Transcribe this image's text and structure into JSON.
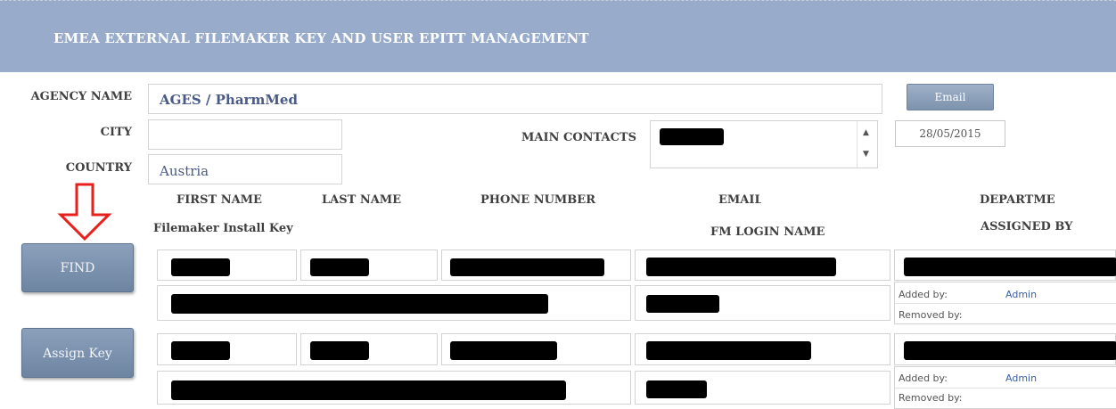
{
  "header": {
    "title": "EMEA EXTERNAL FILEMAKER KEY AND USER EPITT MANAGEMENT"
  },
  "form": {
    "agency_label": "AGENCY NAME",
    "agency_value": "AGES / PharmMed",
    "city_label": "CITY",
    "city_value": "",
    "country_label": "COUNTRY",
    "country_value": "Austria",
    "main_contacts_label": "MAIN CONTACTS",
    "email_button": "Email",
    "date": "28/05/2015"
  },
  "columns": {
    "first_name": "FIRST NAME",
    "last_name": "LAST NAME",
    "phone": "PHONE NUMBER",
    "email": "EMAIL ADDRESS",
    "department": "DEPARTMENT",
    "install_key": "Filemaker Install Key",
    "fm_login": "FM LOGIN NAME",
    "assigned_by": "ASSIGNED BY"
  },
  "buttons": {
    "find": "FIND",
    "assign_key": "Assign Key"
  },
  "records": [
    {
      "added_by_label": "Added by:",
      "added_by_value": "Admin",
      "removed_by_label": "Removed by:"
    },
    {
      "added_by_label": "Added by:",
      "added_by_value": "Admin",
      "removed_by_label": "Removed by:"
    }
  ],
  "annotation": {
    "arrow_color": "#e8201c"
  },
  "colors": {
    "header": "#98abcb",
    "button": "#7d92ad",
    "value_text": "#4a5a88"
  }
}
